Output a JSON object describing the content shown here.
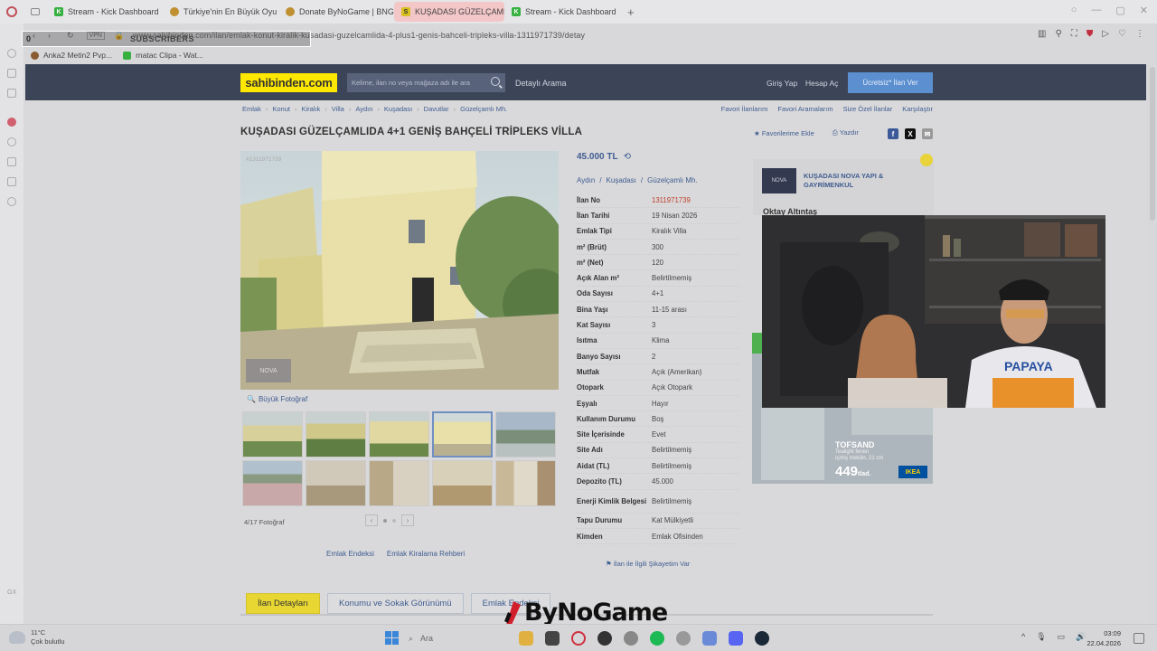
{
  "browser": {
    "tabs": [
      {
        "label": "Stream - Kick Dashboard",
        "fav_color": "#36b040",
        "fav_text": "K",
        "active": false
      },
      {
        "label": "Türkiye'nin En Büyük Oyu",
        "fav_color": "#c09030",
        "fav_text": "",
        "active": false
      },
      {
        "label": "Donate ByNoGame | BNG",
        "fav_color": "#c09030",
        "fav_text": "",
        "active": false
      },
      {
        "label": "KUŞADASI GÜZELÇAMLI...",
        "fav_color": "#d8c020",
        "fav_text": "S",
        "active": true
      },
      {
        "label": "Stream - Kick Dashboard",
        "fav_color": "#36b040",
        "fav_text": "K",
        "active": false
      }
    ],
    "new_tab": "+",
    "vpn": "VPN",
    "url": "www.sahibinden.com/ilan/emlak-konut-kiralik-kusadasi-guzelcamlida-4-plus1-genis-bahceli-tripleks-villa-1311971739/detay",
    "overlay_count": "0",
    "overlay_label": "SUBSCRIBERS",
    "bookmarks": [
      {
        "label": "Anka2 Metin2 Pvp...",
        "color": "#8a5a30"
      },
      {
        "label": "rnatac Clipa - Wat...",
        "color": "#36b040"
      }
    ]
  },
  "site": {
    "logo": "sahibinden.com",
    "search_placeholder": "Kelime, ilan no veya mağaza adı ile ara",
    "detailed_search": "Detaylı Arama",
    "login": "Giriş Yap",
    "signup": "Hesap Aç",
    "post_ad": "Ücretsiz* İlan Ver",
    "breadcrumbs": [
      "Emlak",
      "Konut",
      "Kiralık",
      "Villa",
      "Aydın",
      "Kuşadası",
      "Davutlar",
      "Güzelçamlı Mh."
    ],
    "top_links": [
      "Favori İlanlarım",
      "Favori Aramalarım",
      "Size Özel İlanlar",
      "Karşılaştır"
    ]
  },
  "listing": {
    "title": "KUŞADASI GÜZELÇAMLIDA 4+1 GENİŞ BAHÇELİ TRİPLEKS VİLLA",
    "add_favorite": "Favorilerime Ekle",
    "print": "Yazdır",
    "photo_id": "#1311971739",
    "photo_brand": "NOVA",
    "large_photo": "Büyük Fotoğraf",
    "photo_count": "4/17 Fotoğraf",
    "price": "45.000 TL",
    "location": [
      "Aydın",
      "Kuşadası",
      "Güzelçamlı Mh."
    ],
    "details": [
      {
        "k": "İlan No",
        "v": "1311971739",
        "red": true
      },
      {
        "k": "İlan Tarihi",
        "v": "19 Nisan 2026"
      },
      {
        "k": "Emlak Tipi",
        "v": "Kiralık Villa"
      },
      {
        "k": "m² (Brüt)",
        "v": "300"
      },
      {
        "k": "m² (Net)",
        "v": "120"
      },
      {
        "k": "Açık Alan m²",
        "v": "Belirtilmemiş"
      },
      {
        "k": "Oda Sayısı",
        "v": "4+1"
      },
      {
        "k": "Bina Yaşı",
        "v": "11-15 arası"
      },
      {
        "k": "Kat Sayısı",
        "v": "3"
      },
      {
        "k": "Isıtma",
        "v": "Klima"
      },
      {
        "k": "Banyo Sayısı",
        "v": "2"
      },
      {
        "k": "Mutfak",
        "v": "Açık (Amerikan)"
      },
      {
        "k": "Otopark",
        "v": "Açık Otopark"
      },
      {
        "k": "Eşyalı",
        "v": "Hayır"
      },
      {
        "k": "Kullanım Durumu",
        "v": "Boş"
      },
      {
        "k": "Site İçerisinde",
        "v": "Evet"
      },
      {
        "k": "Site Adı",
        "v": "Belirtilmemiş"
      },
      {
        "k": "Aidat (TL)",
        "v": "Belirtilmemiş"
      },
      {
        "k": "Depozito (TL)",
        "v": "45.000"
      },
      {
        "k": "Enerji Kimlik Belgesi",
        "v": "Belirtilmemiş",
        "tall": true
      },
      {
        "k": "Tapu Durumu",
        "v": "Kat Mülkiyetli"
      },
      {
        "k": "Kimden",
        "v": "Emlak Ofisinden"
      }
    ],
    "complaint": "İlan ile İlgili Şikayetim Var",
    "bottom_links": [
      "Emlak Endeksi",
      "Emlak Kiralama Rehberi"
    ],
    "detail_tabs": [
      "İlan Detayları",
      "Konumu ve Sokak Görünümü",
      "Emlak Endeksi"
    ]
  },
  "store": {
    "logo": "NOVA",
    "name_line1": "KUŞADASI NOVA YAPI &",
    "name_line2": "GAYRİMENKUL",
    "owner": "Oktay Altıntaş"
  },
  "ad": {
    "name": "TOFSAND",
    "desc_line1": "Tealight fenen",
    "desc_line2": "iç/dış mekân, 21 cm",
    "price": "449",
    "unit": "t/ad.",
    "brand": "IKEA"
  },
  "watermark": "ByNoGame",
  "taskbar": {
    "temp": "11°C",
    "weather": "Çok bulutlu",
    "search": "Ara",
    "time": "03:09",
    "date": "22.04.2026"
  }
}
